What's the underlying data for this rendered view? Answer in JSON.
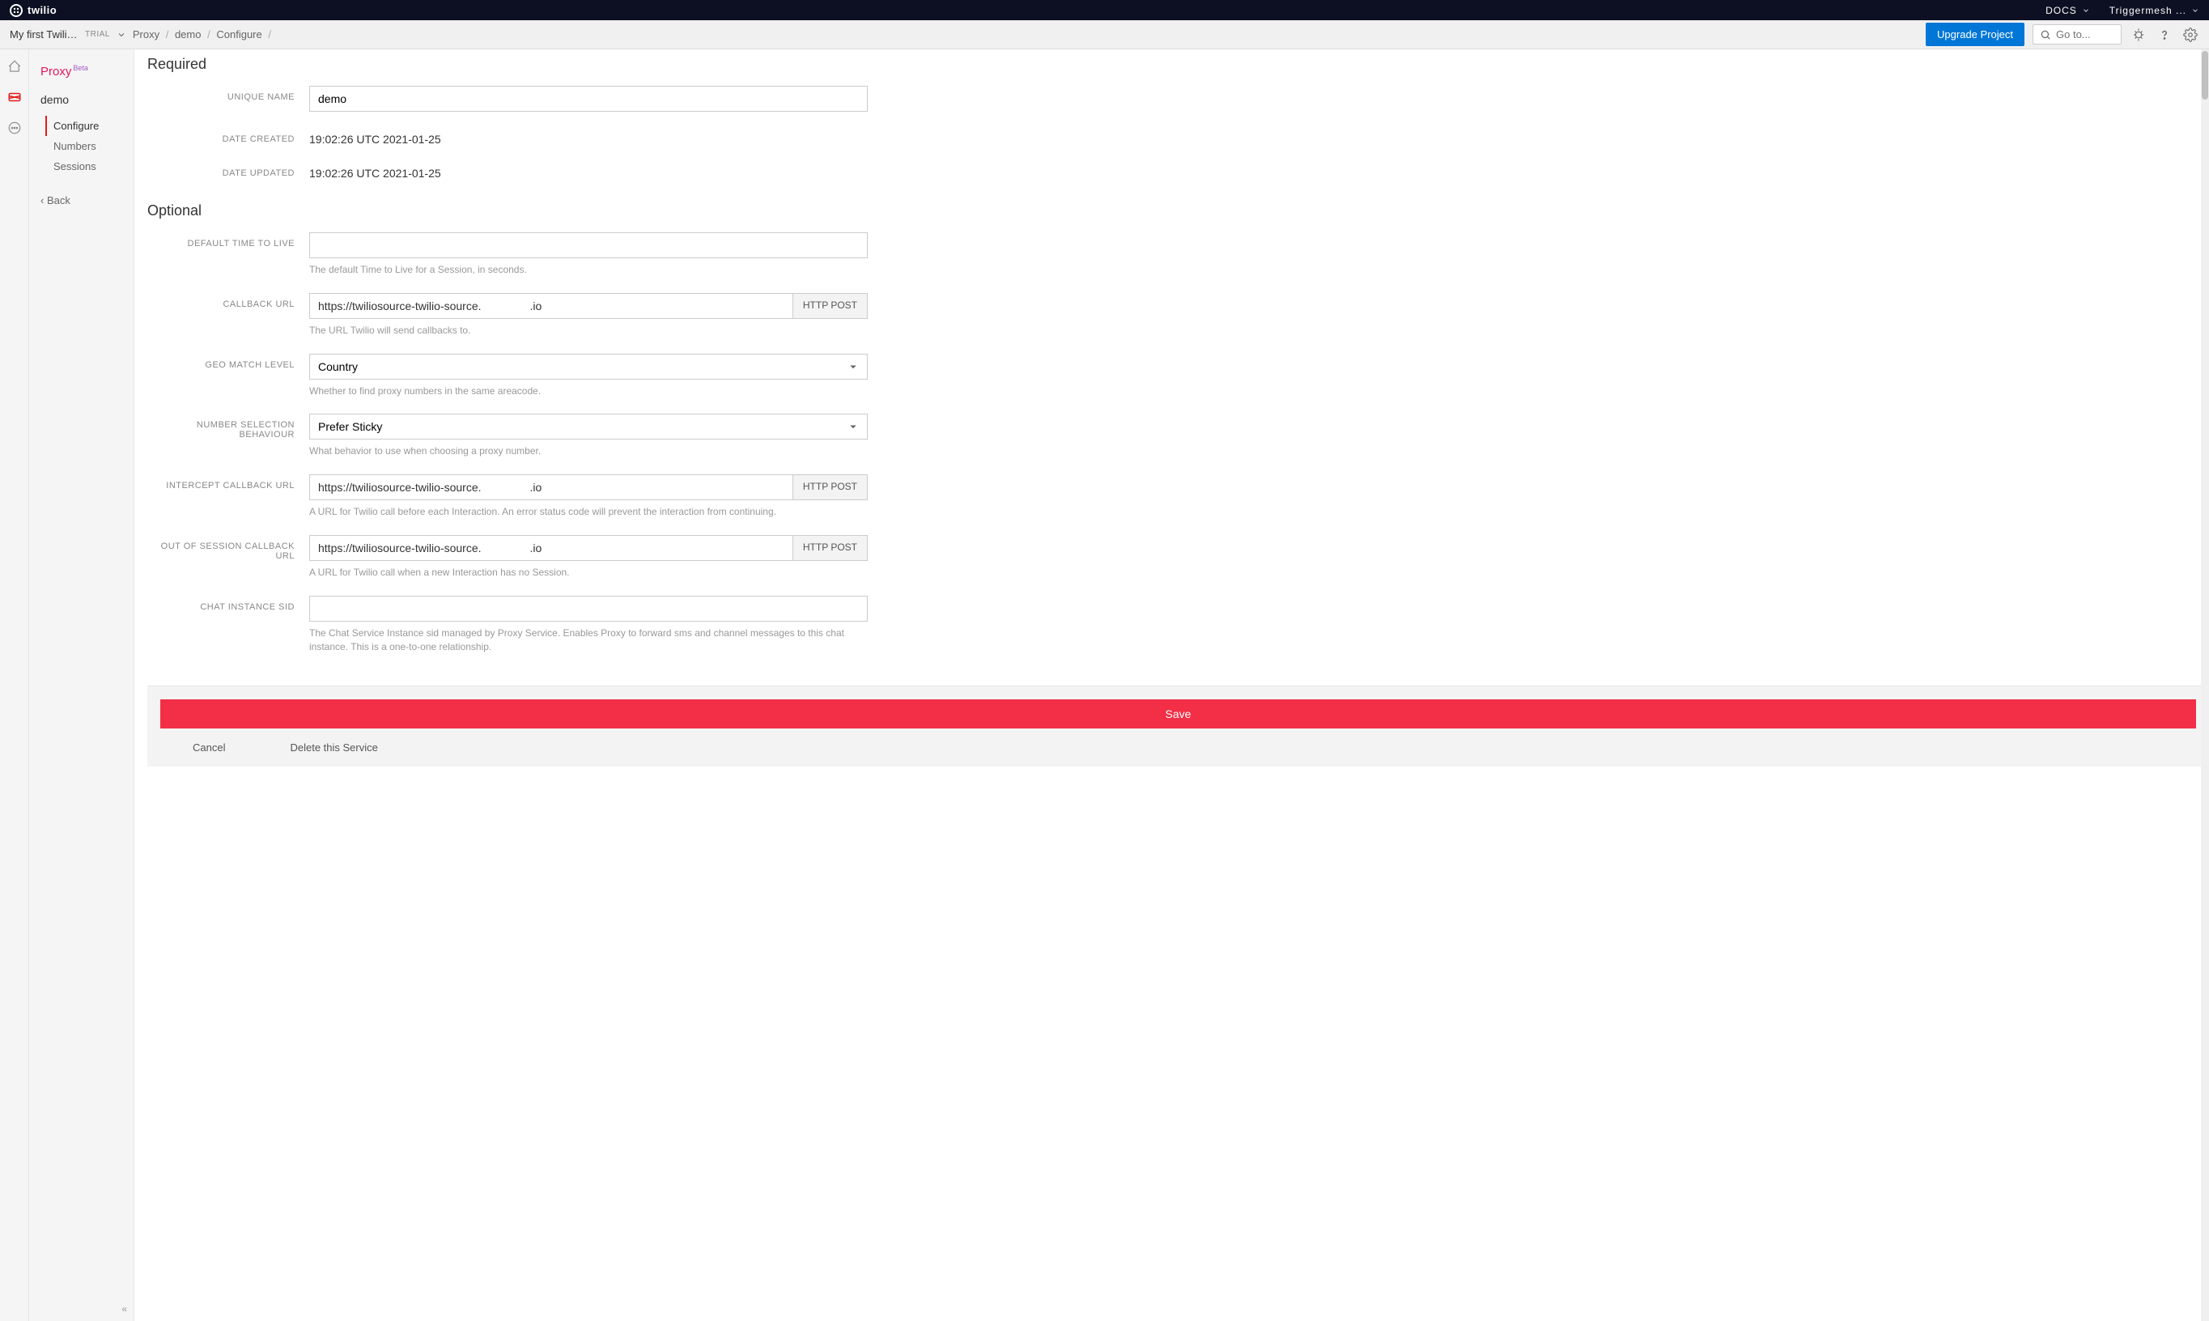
{
  "topbar": {
    "logo_text": "twilio",
    "docs": "DOCS",
    "account": "Triggermesh ..."
  },
  "subbar": {
    "project_name": "My first Twilio...",
    "trial": "TRIAL",
    "breadcrumb": [
      "Proxy",
      "demo",
      "Configure"
    ],
    "upgrade": "Upgrade Project",
    "search_placeholder": "Go to..."
  },
  "sidebar": {
    "title": "Proxy",
    "beta": "Beta",
    "service": "demo",
    "items": [
      {
        "label": "Configure",
        "active": true
      },
      {
        "label": "Numbers",
        "active": false
      },
      {
        "label": "Sessions",
        "active": false
      }
    ],
    "back": "Back"
  },
  "form": {
    "section_required": "Required",
    "section_optional": "Optional",
    "labels": {
      "unique_name": "UNIQUE NAME",
      "date_created": "DATE CREATED",
      "date_updated": "DATE UPDATED",
      "ttl": "DEFAULT TIME TO LIVE",
      "callback": "CALLBACK URL",
      "geo": "GEO MATCH LEVEL",
      "nsb": "NUMBER SELECTION BEHAVIOUR",
      "intercept": "INTERCEPT CALLBACK URL",
      "oos": "OUT OF SESSION CALLBACK URL",
      "chat": "CHAT INSTANCE SID"
    },
    "values": {
      "unique_name": "demo",
      "date_created": "19:02:26 UTC 2021-01-25",
      "date_updated": "19:02:26 UTC 2021-01-25",
      "ttl": "",
      "callback_prefix": "https://twiliosource-twilio-source.",
      "callback_suffix": ".io",
      "geo": "Country",
      "nsb": "Prefer Sticky",
      "intercept_prefix": "https://twiliosource-twilio-source.",
      "intercept_suffix": ".io",
      "oos_prefix": "https://twiliosource-twilio-source.",
      "oos_suffix": ".io",
      "chat": ""
    },
    "suffixes": {
      "http_post": "HTTP POST"
    },
    "hints": {
      "ttl": "The default Time to Live for a Session, in seconds.",
      "callback": "The URL Twilio will send callbacks to.",
      "geo": "Whether to find proxy numbers in the same areacode.",
      "nsb": "What behavior to use when choosing a proxy number.",
      "intercept": "A URL for Twilio call before each Interaction. An error status code will prevent the interaction from continuing.",
      "oos": "A URL for Twilio call when a new Interaction has no Session.",
      "chat": "The Chat Service Instance sid managed by Proxy Service. Enables Proxy to forward sms and channel messages to this chat instance. This is a one-to-one relationship."
    }
  },
  "footer": {
    "save": "Save",
    "cancel": "Cancel",
    "delete": "Delete this Service"
  }
}
